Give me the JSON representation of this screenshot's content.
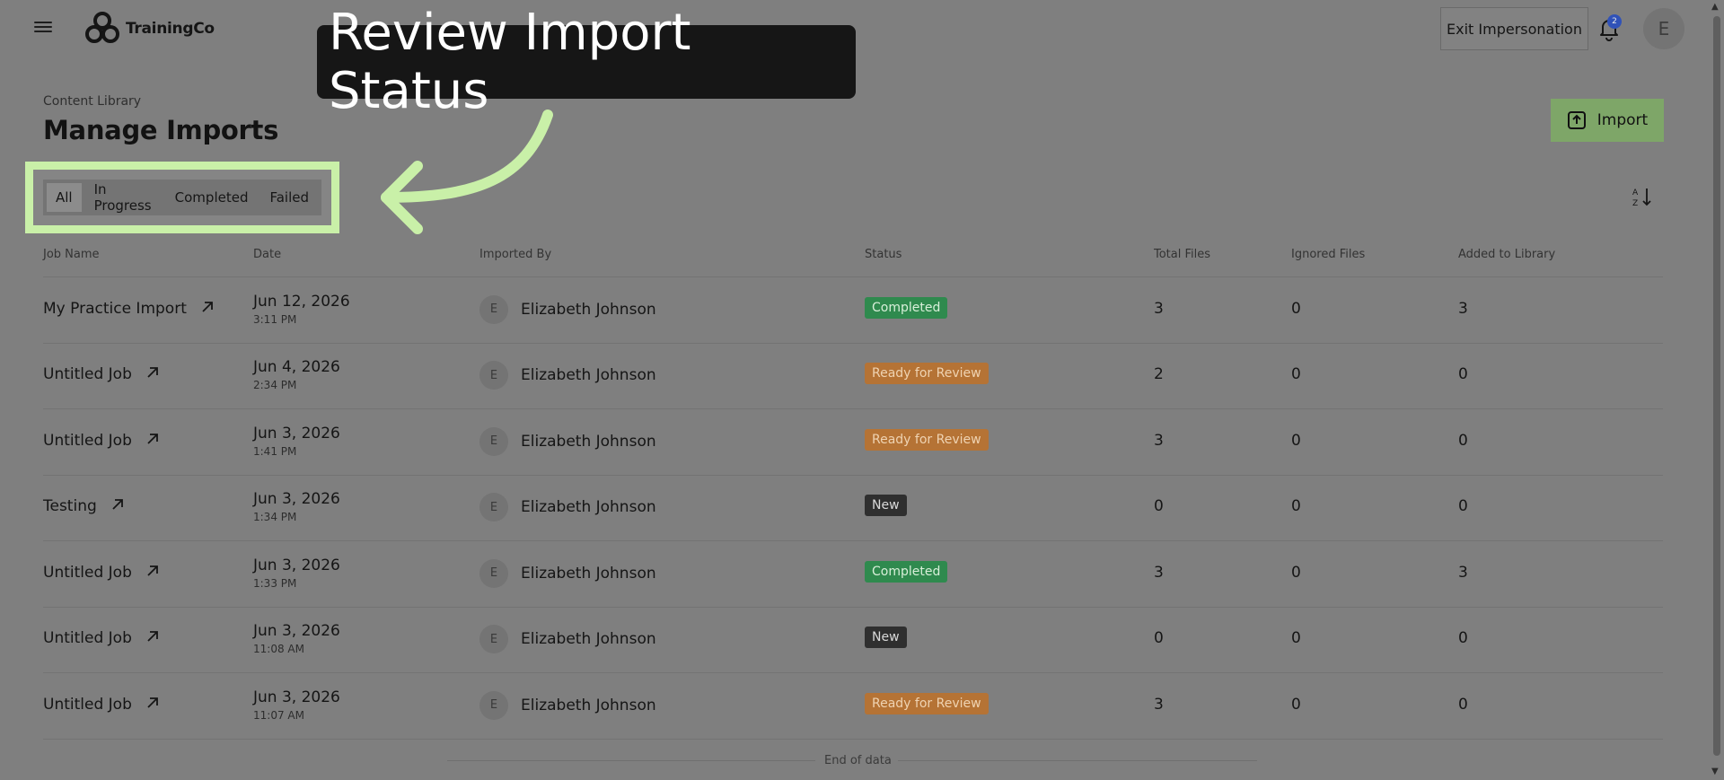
{
  "app": {
    "logo_text": "TrainingCo"
  },
  "topbar": {
    "exit_label": "Exit Impersonation",
    "notification_count": "2",
    "user_initial": "E"
  },
  "header": {
    "breadcrumb": "Content Library",
    "title": "Manage Imports",
    "import_label": "Import"
  },
  "tabs": [
    {
      "label": "All",
      "active": true
    },
    {
      "label": "In Progress",
      "active": false
    },
    {
      "label": "Completed",
      "active": false
    },
    {
      "label": "Failed",
      "active": false
    }
  ],
  "annotation": {
    "text": "Review Import Status",
    "highlight_color": "#c9f0a8"
  },
  "table": {
    "columns": [
      "Job Name",
      "Date",
      "Imported By",
      "Status",
      "Total Files",
      "Ignored Files",
      "Added to Library"
    ],
    "rows": [
      {
        "job": "My Practice Import",
        "date": "Jun 12, 2026",
        "time": "3:11 PM",
        "user_initial": "E",
        "user": "Elizabeth Johnson",
        "status": "Completed",
        "total": "3",
        "ignored": "0",
        "added": "3"
      },
      {
        "job": "Untitled Job",
        "date": "Jun 4, 2026",
        "time": "2:34 PM",
        "user_initial": "E",
        "user": "Elizabeth Johnson",
        "status": "Ready for Review",
        "total": "2",
        "ignored": "0",
        "added": "0"
      },
      {
        "job": "Untitled Job",
        "date": "Jun 3, 2026",
        "time": "1:41 PM",
        "user_initial": "E",
        "user": "Elizabeth Johnson",
        "status": "Ready for Review",
        "total": "3",
        "ignored": "0",
        "added": "0"
      },
      {
        "job": "Testing",
        "date": "Jun 3, 2026",
        "time": "1:34 PM",
        "user_initial": "E",
        "user": "Elizabeth Johnson",
        "status": "New",
        "total": "0",
        "ignored": "0",
        "added": "0"
      },
      {
        "job": "Untitled Job",
        "date": "Jun 3, 2026",
        "time": "1:33 PM",
        "user_initial": "E",
        "user": "Elizabeth Johnson",
        "status": "Completed",
        "total": "3",
        "ignored": "0",
        "added": "3"
      },
      {
        "job": "Untitled Job",
        "date": "Jun 3, 2026",
        "time": "11:08 AM",
        "user_initial": "E",
        "user": "Elizabeth Johnson",
        "status": "New",
        "total": "0",
        "ignored": "0",
        "added": "0"
      },
      {
        "job": "Untitled Job",
        "date": "Jun 3, 2026",
        "time": "11:07 AM",
        "user_initial": "E",
        "user": "Elizabeth Johnson",
        "status": "Ready for Review",
        "total": "3",
        "ignored": "0",
        "added": "0"
      }
    ],
    "end_text": "End of data"
  },
  "status_colors": {
    "Completed": {
      "bg": "#2f8a4e",
      "fg": "#d8efd9"
    },
    "Ready for Review": {
      "bg": "#b57335",
      "fg": "#efd3b2"
    },
    "New": {
      "bg": "#2f2f2f",
      "fg": "#d9d9d9"
    }
  }
}
